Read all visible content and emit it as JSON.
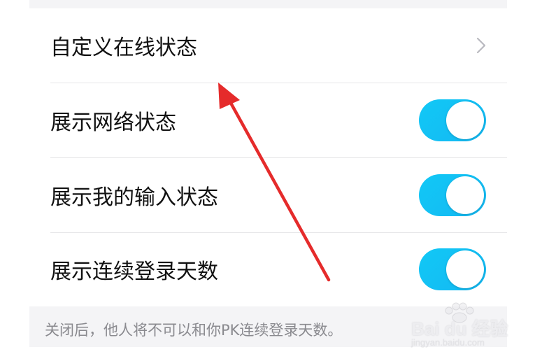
{
  "settings": {
    "items": [
      {
        "label": "自定义在线状态",
        "control": "chevron"
      },
      {
        "label": "展示网络状态",
        "control": "toggle",
        "enabled": true
      },
      {
        "label": "展示我的输入状态",
        "control": "toggle",
        "enabled": true
      },
      {
        "label": "展示连续登录天数",
        "control": "toggle",
        "enabled": true
      }
    ],
    "footnote": "关闭后，他人将不可以和你PK连续登录天数。"
  },
  "watermark": {
    "brand": "Bai du 经验",
    "domain": "jingyan.baidu.com"
  },
  "colors": {
    "toggle_on": "#12c8f6",
    "annotation_arrow": "#e52b2b",
    "background": "#f4f4f6"
  },
  "icons": {
    "chevron": "chevron-right-icon"
  }
}
